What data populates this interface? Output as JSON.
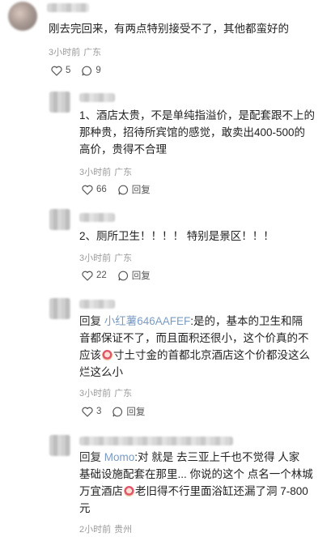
{
  "comments": [
    {
      "text": "刚去完回来，有两点特别接受不了，其他都蛮好的",
      "time": "3小时前",
      "location": "广东",
      "likes": "5",
      "replies": "9"
    }
  ],
  "replies": [
    {
      "line1": "1、酒店太贵，不是单纯指溢价，是配套跟不上的",
      "line2": "那种贵，招待所宾馆的感觉，敢卖出400-500的",
      "line3": "高价，贵得不合理",
      "time": "3小时前",
      "location": "广东",
      "likes": "66",
      "reply_label": "回复"
    },
    {
      "line1": "2、厕所卫生！！！！ 特别是景区！！！",
      "time": "3小时前",
      "location": "广东",
      "likes": "22",
      "reply_label": "回复"
    },
    {
      "reply_prefix": "回复",
      "mention": "小红薯646AAFEF",
      "line1_rest": ":是的，基本的卫生和隔",
      "line2": "音都保证不了，而且面积还很小，这个价真的不",
      "line3_a": "应该",
      "line3_b": "寸土寸金的首都北京酒店这个价都没这么",
      "line4": "烂这么小",
      "time": "3小时前",
      "location": "广东",
      "likes": "3",
      "reply_label": "回复"
    },
    {
      "reply_prefix": "回复",
      "mention": "Momo",
      "line1_rest": ":对 就是 去三亚上千也不觉得 人家",
      "line2": "基础设施配套在那里... 你说的这个 点名一个林城",
      "line3_a": "万宜酒店",
      "line3_b": "老旧得不行里面浴缸还漏了洞 7-800",
      "line4": "元",
      "time": "2小时前",
      "location": "贵州"
    }
  ],
  "icons": {
    "like": "heart-outline-icon",
    "comment": "speech-bubble-icon",
    "emoji": "crying-face-emoji"
  }
}
